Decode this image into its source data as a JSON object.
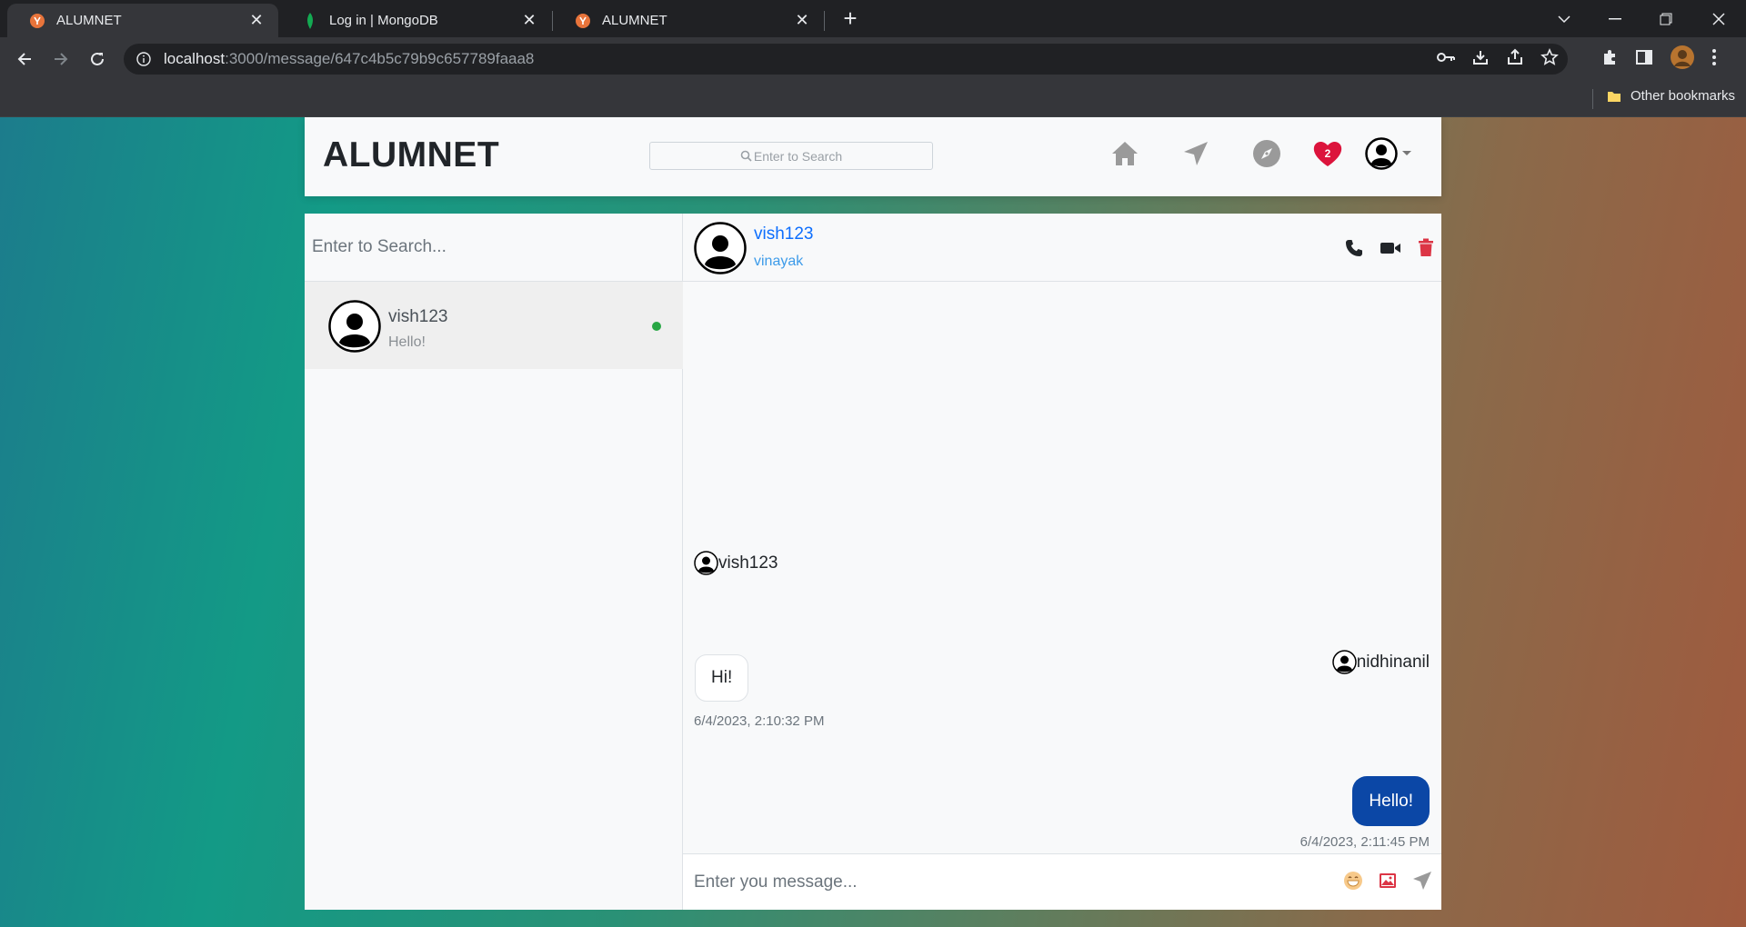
{
  "browser": {
    "tabs": [
      {
        "title": "ALUMNET",
        "active": true
      },
      {
        "title": "Log in | MongoDB",
        "active": false
      },
      {
        "title": "ALUMNET",
        "active": false
      }
    ],
    "url_host": "localhost",
    "url_path": ":3000/message/647c4b5c79b9c657789faaa8",
    "bookmarks_other": "Other bookmarks"
  },
  "navbar": {
    "brand": "ALUMNET",
    "search_placeholder": "Enter to Search",
    "notification_count": "2",
    "icons": [
      "home-icon",
      "send-icon",
      "explore-icon",
      "heart-icon",
      "avatar-icon",
      "caret-down-icon"
    ]
  },
  "sidebar": {
    "search_placeholder": "Enter to Search...",
    "conversations": [
      {
        "username": "vish123",
        "last_message": "Hello!",
        "online": true
      }
    ]
  },
  "chat": {
    "header": {
      "username": "vish123",
      "fullname": "vinayak"
    },
    "messages": [
      {
        "sender": "vish123",
        "text": "Hi!",
        "time": "6/4/2023, 2:10:32 PM",
        "direction": "incoming"
      },
      {
        "sender": "nidhinanil",
        "text": "Hello!",
        "time": "6/4/2023, 2:11:45 PM",
        "direction": "outgoing"
      }
    ],
    "composer_placeholder": "Enter you message..."
  },
  "colors": {
    "accent": "#0d6efd",
    "outgoing_bubble": "#0b47a6",
    "online": "#28a745",
    "heart": "#dc143c",
    "delete": "#dc3545"
  }
}
